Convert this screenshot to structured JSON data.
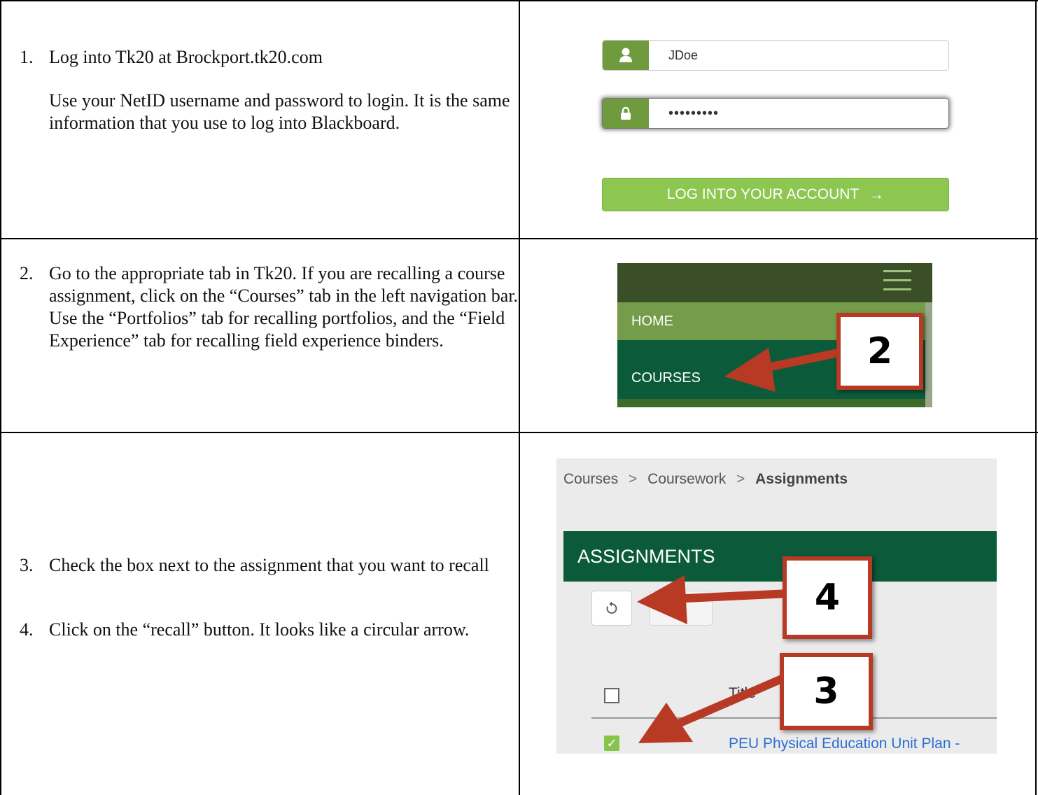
{
  "steps": [
    {
      "number": "1.",
      "text": "Log into Tk20 at Brockport.tk20.com",
      "detail": "Use your NetID username and password to login. It is the same information that you use to log into Blackboard."
    },
    {
      "number": "2.",
      "text": "Go to the appropriate tab in Tk20. If you are recalling a course assignment, click on the “Courses” tab in the left navigation bar. Use the “Portfolios” tab for recalling portfolios, and the “Field Experience” tab for recalling field experience binders."
    },
    {
      "number": "3.",
      "text": "Check the box next to the assignment that you want to recall"
    },
    {
      "number": "4.",
      "text": "Click on the “recall” button. It looks like a circular arrow."
    }
  ],
  "login": {
    "username_value": "JDoe",
    "password_value": "•••••••••",
    "button_label": "LOG INTO YOUR ACCOUNT",
    "button_arrow": "→",
    "user_icon": "user-icon",
    "lock_icon": "lock-icon",
    "accent_color": "#8ec652"
  },
  "nav": {
    "home_label": "HOME",
    "courses_label": "COURSES",
    "callout": "2"
  },
  "assignments": {
    "breadcrumb": [
      "Courses",
      "Coursework",
      "Assignments"
    ],
    "breadcrumb_sep": ">",
    "header": "ASSIGNMENTS",
    "title_column": "Title",
    "row_title": "PEU Physical Education Unit Plan -",
    "recall_icon": "recall-icon",
    "callout_recall": "4",
    "callout_checkbox": "3"
  }
}
